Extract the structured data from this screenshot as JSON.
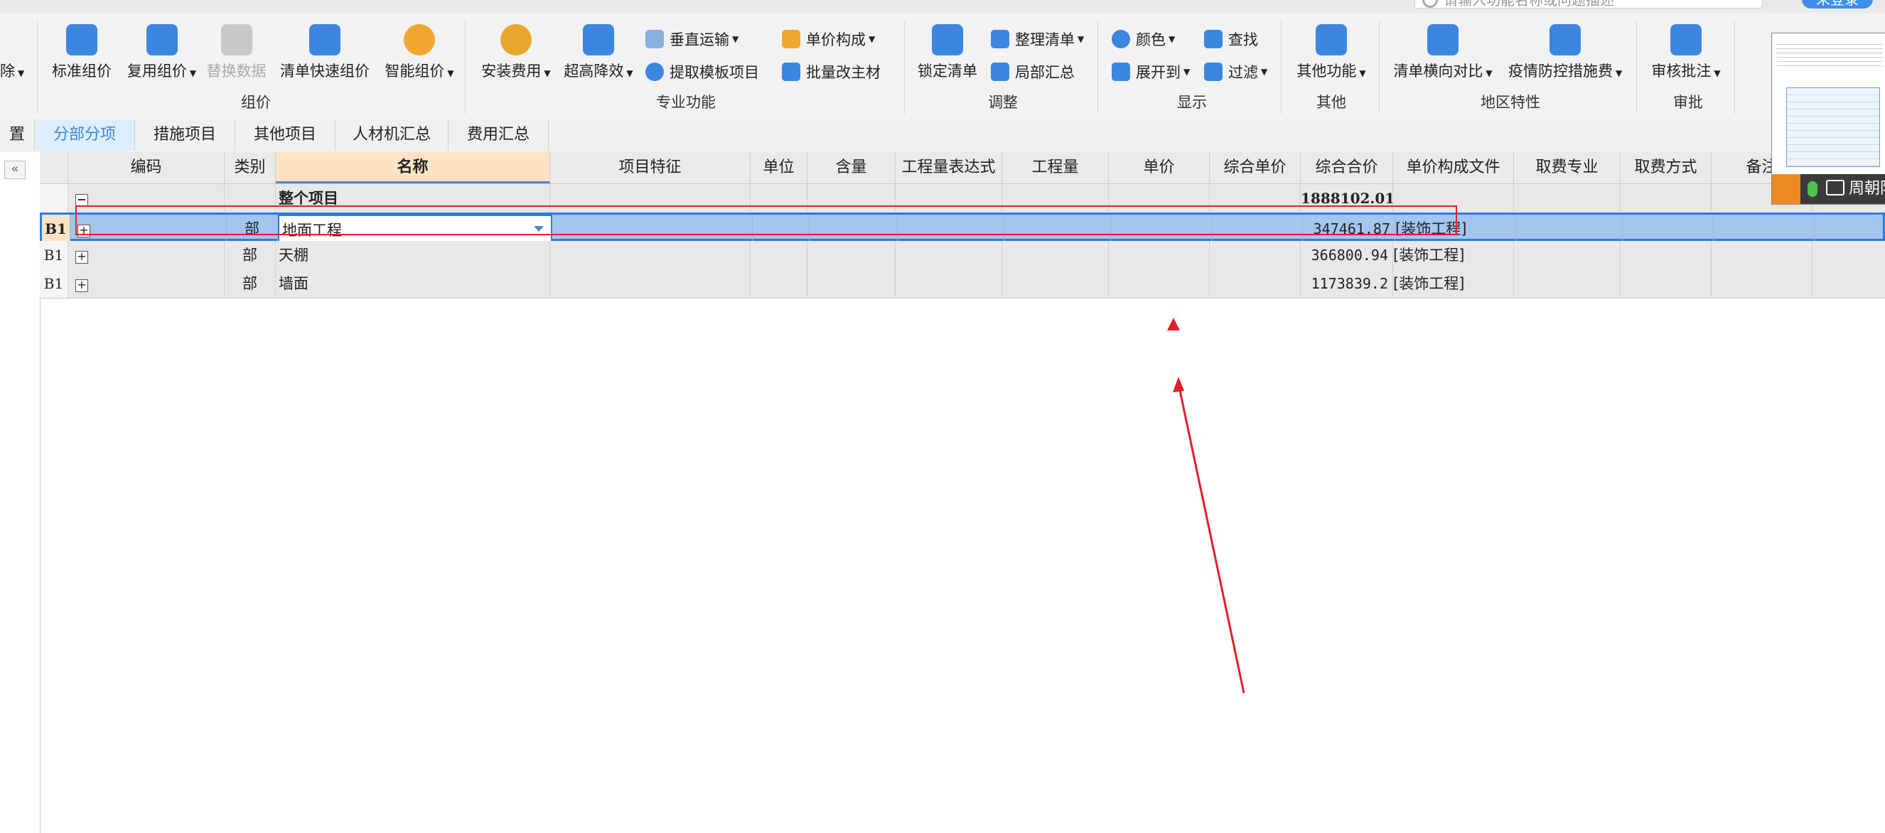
{
  "search": {
    "placeholder": "请输入功能名称或问题描述"
  },
  "login": {
    "label": "未登录"
  },
  "ribbon": {
    "left_clip": "除",
    "groups": {
      "zujia": {
        "label": "组价",
        "buttons": [
          "标准组价",
          "复用组价",
          "替换数据",
          "清单快速组价",
          "智能组价"
        ]
      },
      "zhuanye": {
        "label": "专业功能",
        "big": [
          "安装费用",
          "超高降效"
        ],
        "small": [
          "垂直运输",
          "提取模板项目",
          "单价构成",
          "批量改主材"
        ]
      },
      "tiaozheng": {
        "label": "调整",
        "big": [
          "锁定清单"
        ],
        "small": [
          "整理清单",
          "局部汇总"
        ]
      },
      "xianshi": {
        "label": "显示",
        "small": [
          "颜色",
          "查找",
          "展开到",
          "过滤"
        ]
      },
      "qita": {
        "label": "其他",
        "big": [
          "其他功能"
        ]
      },
      "diqu": {
        "label": "地区特性",
        "big": [
          "清单横向对比",
          "疫情防控措施费"
        ]
      },
      "shenpi": {
        "label": "审批",
        "big": [
          "审核批注"
        ]
      }
    }
  },
  "tabs": [
    "置",
    "分部分项",
    "措施项目",
    "其他项目",
    "人材机汇总",
    "费用汇总"
  ],
  "grid": {
    "headers": [
      "编码",
      "类别",
      "名称",
      "项目特征",
      "单位",
      "含量",
      "工程量表达式",
      "工程量",
      "单价",
      "综合单价",
      "综合合价",
      "单价构成文件",
      "取费专业",
      "取费方式",
      "备注"
    ],
    "rows": [
      {
        "num": "",
        "toggle": "−",
        "type": "",
        "name": "整个项目",
        "total": "1888102.01",
        "file": ""
      },
      {
        "num": "B1",
        "toggle": "+",
        "type": "部",
        "name": "地面工程",
        "total": "347461.87",
        "file": "[装饰工程]"
      },
      {
        "num": "B1",
        "toggle": "+",
        "type": "部",
        "name": "天棚",
        "total": "366800.94",
        "file": "[装饰工程]"
      },
      {
        "num": "B1",
        "toggle": "+",
        "type": "部",
        "name": "墙面",
        "total": "1173839.2",
        "file": "[装饰工程]"
      }
    ]
  },
  "video": {
    "name": "周朝阳"
  },
  "colors": {
    "accent": "#2b7de0",
    "annotation": "#e0202a",
    "selected_row": "#a4c5ec",
    "header_name": "#fde3c4"
  }
}
